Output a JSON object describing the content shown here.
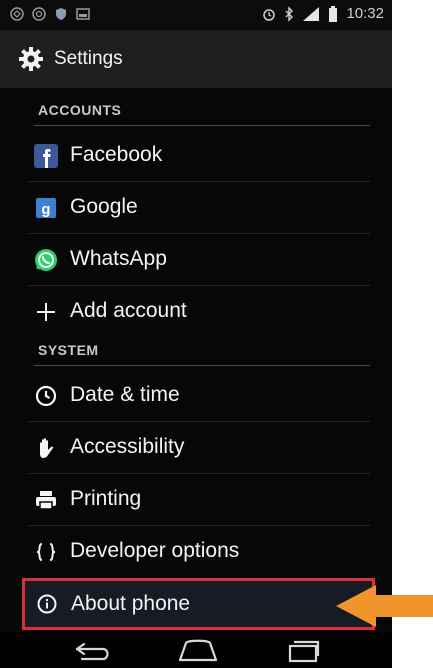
{
  "status_bar": {
    "time": "10:32",
    "left_icons": [
      "notification-icon",
      "notification-icon",
      "shield-icon",
      "image-icon"
    ],
    "right_icons": [
      "alarm-icon",
      "bluetooth-icon",
      "signal-icon",
      "battery-icon"
    ]
  },
  "action_bar": {
    "title": "Settings",
    "icon": "gear-icon"
  },
  "sections": [
    {
      "header": "ACCOUNTS"
    },
    {
      "header": "SYSTEM"
    }
  ],
  "accounts": [
    {
      "label": "Facebook",
      "icon": "facebook-icon",
      "color": "#3b5998"
    },
    {
      "label": "Google",
      "icon": "google-icon",
      "color": "#3e7fd6"
    },
    {
      "label": "WhatsApp",
      "icon": "whatsapp-icon",
      "color": "#25d366"
    },
    {
      "label": "Add account",
      "icon": "plus-icon"
    }
  ],
  "system": [
    {
      "label": "Date & time",
      "icon": "clock-icon"
    },
    {
      "label": "Accessibility",
      "icon": "hand-icon"
    },
    {
      "label": "Printing",
      "icon": "printer-icon"
    },
    {
      "label": "Developer options",
      "icon": "braces-icon"
    },
    {
      "label": "About phone",
      "icon": "info-icon",
      "highlighted": true
    }
  ],
  "nav_bar": {
    "buttons": [
      "back-icon",
      "home-icon",
      "recents-icon"
    ]
  },
  "annotation": {
    "highlight_color": "#d8313b",
    "arrow_color": "#f0952c"
  }
}
